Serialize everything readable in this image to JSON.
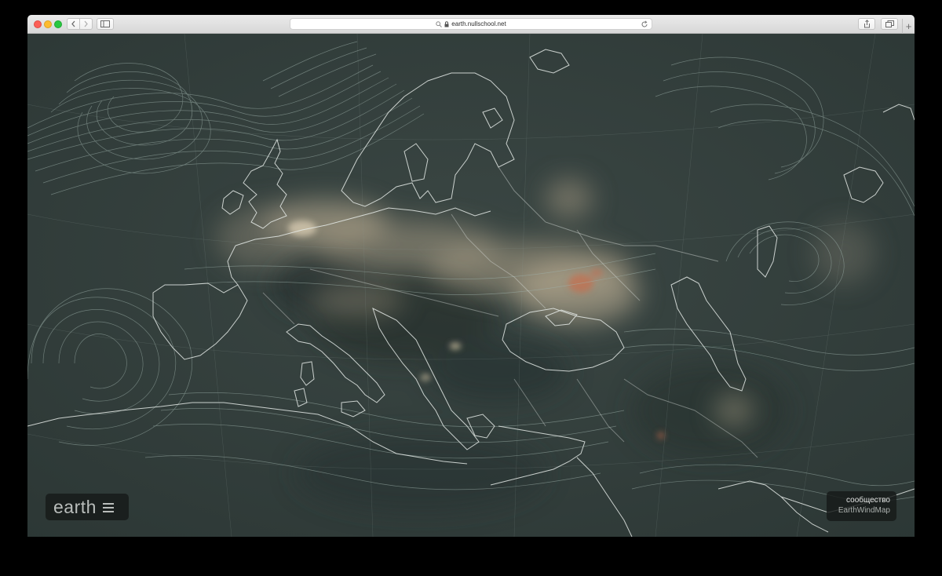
{
  "browser": {
    "url": "earth.nullschool.net",
    "lock_icon": "lock-icon",
    "search_icon": "search-icon",
    "reload_icon": "reload-icon",
    "share_icon": "share-icon",
    "tabs_icon": "tabs-overview-icon",
    "sidebar_icon": "sidebar-icon",
    "new_tab_label": "+"
  },
  "app": {
    "logo_text": "earth",
    "menu_icon": "hamburger-menu-icon",
    "community_label": "сообщество",
    "community_link": "EarthWindMap"
  },
  "colors": {
    "map_background": "#34403d",
    "coastline": "#e6ebe8",
    "wind_streak": "#9fb2ac",
    "aerosol_haze": "#c9b89a",
    "aerosol_hotspot": "#c96a4a"
  }
}
